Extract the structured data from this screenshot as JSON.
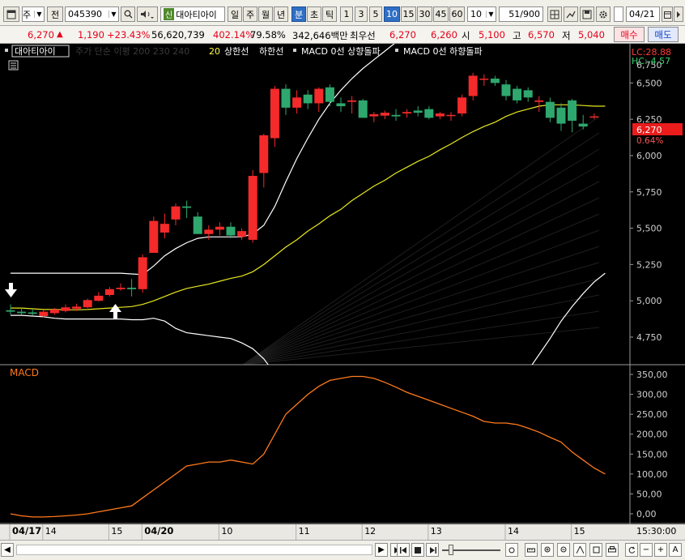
{
  "toolbar": {
    "market": "주",
    "view": "전",
    "code": "045390",
    "stock_name": "대아티아이",
    "badge": "신",
    "periods": [
      "일",
      "주",
      "월",
      "년",
      "분",
      "초",
      "틱"
    ],
    "active_period": "분",
    "intervals": [
      "1",
      "3",
      "5",
      "10",
      "15",
      "30",
      "45",
      "60"
    ],
    "active_interval": "10",
    "interval_value": "10",
    "count": "51",
    "count_total": "/900",
    "date_value": "04/21"
  },
  "quote": {
    "price": "6,270",
    "change_arrow": "▲",
    "change": "1,190",
    "change_pct": "+23.43%",
    "volume": "56,620,739",
    "volume_ratio": "402.14%",
    "turnover": "79.58%",
    "amount": "342,646백만",
    "best_bid_label": "최우선",
    "best_ask": "6,270",
    "best_bid": "6,260",
    "open_label": "시",
    "open": "5,100",
    "high_label": "고",
    "high": "6,570",
    "low_label": "저",
    "low": "5,040",
    "buy_label": "매수",
    "sell_label": "매도"
  },
  "legend": {
    "stock": "대아티아이",
    "ma_label": "주가 단순 이평 200 230 240",
    "envelope_period": "20",
    "envelope_upper": "상한선",
    "envelope_lower": "하한선",
    "macd_up": "MACD 0선 상향돌파",
    "macd_down": "MACD 0선 하향돌파",
    "lc": "LC:28.88",
    "hc": "HC:-4.57"
  },
  "price_axis": {
    "ticks": [
      "6,500",
      "6,250",
      "6,000",
      "5,750",
      "5,500",
      "5,250",
      "5,000",
      "4,750"
    ],
    "top_partial": "6,750",
    "current_price": "6,270",
    "current_pct": "0.64%"
  },
  "macd_panel": {
    "label": "MACD",
    "ticks": [
      "350,00",
      "300,00",
      "250,00",
      "200,00",
      "150,00",
      "100,00",
      "50,00",
      "0,00"
    ]
  },
  "time_axis": {
    "labels": [
      "04/17",
      "14",
      "15",
      "04/20",
      "10",
      "11",
      "12",
      "13",
      "14",
      "15"
    ],
    "clock": "15:30:00"
  },
  "chart_data": [
    {
      "type": "candlestick",
      "title": "",
      "ylim": [
        4560,
        6770
      ],
      "y_ticks": [
        4750,
        5000,
        5250,
        5500,
        5750,
        6000,
        6250,
        6500
      ],
      "grid": false,
      "legend_position": "top-left",
      "colors": {
        "up": "#f52a2a",
        "down": "#2ea86e",
        "ma": "#e8e81f",
        "envelope": "#ffffff",
        "background": "#000000"
      },
      "candles": [
        {
          "o": 4935,
          "h": 4975,
          "l": 4905,
          "c": 4925
        },
        {
          "o": 4925,
          "h": 4950,
          "l": 4905,
          "c": 4915
        },
        {
          "o": 4920,
          "h": 4945,
          "l": 4900,
          "c": 4910
        },
        {
          "o": 4895,
          "h": 4935,
          "l": 4885,
          "c": 4925
        },
        {
          "o": 4915,
          "h": 4950,
          "l": 4905,
          "c": 4940
        },
        {
          "o": 4930,
          "h": 4975,
          "l": 4920,
          "c": 4955
        },
        {
          "o": 4945,
          "h": 4980,
          "l": 4930,
          "c": 4960
        },
        {
          "o": 4955,
          "h": 5015,
          "l": 4950,
          "c": 5005
        },
        {
          "o": 5000,
          "h": 5060,
          "l": 4995,
          "c": 5035
        },
        {
          "o": 5040,
          "h": 5095,
          "l": 5030,
          "c": 5080
        },
        {
          "o": 5080,
          "h": 5120,
          "l": 5070,
          "c": 5090
        },
        {
          "o": 5090,
          "h": 5150,
          "l": 5030,
          "c": 5080
        },
        {
          "o": 5080,
          "h": 5320,
          "l": 5055,
          "c": 5300
        },
        {
          "o": 5330,
          "h": 5580,
          "l": 5330,
          "c": 5550
        },
        {
          "o": 5470,
          "h": 5600,
          "l": 5430,
          "c": 5530
        },
        {
          "o": 5560,
          "h": 5670,
          "l": 5520,
          "c": 5650
        },
        {
          "o": 5650,
          "h": 5690,
          "l": 5570,
          "c": 5640
        },
        {
          "o": 5580,
          "h": 5610,
          "l": 5460,
          "c": 5460
        },
        {
          "o": 5460,
          "h": 5520,
          "l": 5420,
          "c": 5490
        },
        {
          "o": 5490,
          "h": 5540,
          "l": 5450,
          "c": 5510
        },
        {
          "o": 5510,
          "h": 5540,
          "l": 5430,
          "c": 5450
        },
        {
          "o": 5440,
          "h": 5500,
          "l": 5420,
          "c": 5480
        },
        {
          "o": 5420,
          "h": 5900,
          "l": 5400,
          "c": 5860
        },
        {
          "o": 5880,
          "h": 6150,
          "l": 5780,
          "c": 6140
        },
        {
          "o": 6120,
          "h": 6480,
          "l": 6060,
          "c": 6460
        },
        {
          "o": 6460,
          "h": 6490,
          "l": 6280,
          "c": 6330
        },
        {
          "o": 6330,
          "h": 6450,
          "l": 6290,
          "c": 6400
        },
        {
          "o": 6420,
          "h": 6450,
          "l": 6320,
          "c": 6360
        },
        {
          "o": 6360,
          "h": 6470,
          "l": 6300,
          "c": 6460
        },
        {
          "o": 6470,
          "h": 6490,
          "l": 6340,
          "c": 6370
        },
        {
          "o": 6360,
          "h": 6400,
          "l": 6300,
          "c": 6340
        },
        {
          "o": 6370,
          "h": 6410,
          "l": 6290,
          "c": 6380
        },
        {
          "o": 6380,
          "h": 6390,
          "l": 6260,
          "c": 6260
        },
        {
          "o": 6270,
          "h": 6300,
          "l": 6230,
          "c": 6285
        },
        {
          "o": 6275,
          "h": 6310,
          "l": 6250,
          "c": 6295
        },
        {
          "o": 6280,
          "h": 6320,
          "l": 6240,
          "c": 6270
        },
        {
          "o": 6290,
          "h": 6320,
          "l": 6260,
          "c": 6300
        },
        {
          "o": 6310,
          "h": 6340,
          "l": 6270,
          "c": 6295
        },
        {
          "o": 6320,
          "h": 6340,
          "l": 6250,
          "c": 6260
        },
        {
          "o": 6270,
          "h": 6300,
          "l": 6250,
          "c": 6290
        },
        {
          "o": 6280,
          "h": 6300,
          "l": 6240,
          "c": 6280
        },
        {
          "o": 6290,
          "h": 6420,
          "l": 6270,
          "c": 6400
        },
        {
          "o": 6410,
          "h": 6570,
          "l": 6380,
          "c": 6550
        },
        {
          "o": 6530,
          "h": 6560,
          "l": 6480,
          "c": 6530
        },
        {
          "o": 6530,
          "h": 6550,
          "l": 6480,
          "c": 6500
        },
        {
          "o": 6490,
          "h": 6520,
          "l": 6380,
          "c": 6410
        },
        {
          "o": 6460,
          "h": 6480,
          "l": 6360,
          "c": 6380
        },
        {
          "o": 6450,
          "h": 6470,
          "l": 6370,
          "c": 6400
        },
        {
          "o": 6370,
          "h": 6410,
          "l": 6300,
          "c": 6380
        },
        {
          "o": 6370,
          "h": 6400,
          "l": 6230,
          "c": 6260
        },
        {
          "o": 6330,
          "h": 6360,
          "l": 6170,
          "c": 6220
        },
        {
          "o": 6380,
          "h": 6390,
          "l": 6160,
          "c": 6240
        },
        {
          "o": 6220,
          "h": 6280,
          "l": 6180,
          "c": 6200
        },
        {
          "o": 6270,
          "h": 6290,
          "l": 6250,
          "c": 6270
        }
      ],
      "ma20": [
        4950,
        4950,
        4945,
        4940,
        4940,
        4938,
        4938,
        4940,
        4945,
        4950,
        4955,
        4960,
        4975,
        5000,
        5030,
        5060,
        5085,
        5100,
        5115,
        5135,
        5155,
        5170,
        5200,
        5250,
        5310,
        5370,
        5420,
        5480,
        5530,
        5585,
        5630,
        5690,
        5740,
        5790,
        5830,
        5880,
        5920,
        5960,
        5995,
        6040,
        6080,
        6125,
        6165,
        6200,
        6230,
        6270,
        6300,
        6320,
        6340,
        6350,
        6350,
        6350,
        6345,
        6340,
        6340
      ],
      "envelope_upper": [
        5190,
        5190,
        5190,
        5190,
        5190,
        5190,
        5190,
        5190,
        5190,
        5190,
        5190,
        5185,
        5180,
        5240,
        5310,
        5360,
        5400,
        5430,
        5440,
        5440,
        5440,
        5440,
        5460,
        5520,
        5650,
        5820,
        5980,
        6120,
        6250,
        6360,
        6450,
        6530,
        6600,
        6660,
        6720,
        6780,
        6830,
        6870,
        6910,
        6950,
        6990,
        7030,
        7060,
        7090,
        7120,
        7150,
        7170,
        7190,
        7210,
        7230,
        7250,
        7270,
        7290,
        7300,
        7310
      ],
      "envelope_lower": [
        4900,
        4900,
        4895,
        4890,
        4880,
        4875,
        4875,
        4875,
        4875,
        4875,
        4875,
        4870,
        4870,
        4880,
        4860,
        4810,
        4780,
        4770,
        4760,
        4750,
        4740,
        4710,
        4670,
        4600,
        4500,
        4400,
        4310,
        4230,
        4150,
        4080,
        4020,
        3960,
        3920,
        3890,
        3870,
        3860,
        3860,
        3870,
        3880,
        3910,
        3950,
        4000,
        4070,
        4150,
        4230,
        4320,
        4420,
        4520,
        4630,
        4740,
        4860,
        4960,
        5050,
        5130,
        5190
      ]
    },
    {
      "type": "line",
      "title": "",
      "ylabel": "MACD",
      "ylim": [
        -10,
        360
      ],
      "y_ticks": [
        0,
        50,
        100,
        150,
        200,
        250,
        300,
        350
      ],
      "series": [
        {
          "name": "MACD",
          "color": "#ff7a1a",
          "values": [
            0,
            -5,
            -8,
            -8,
            -7,
            -5,
            -3,
            0,
            5,
            10,
            15,
            20,
            40,
            60,
            80,
            100,
            120,
            125,
            130,
            130,
            135,
            130,
            125,
            150,
            200,
            250,
            275,
            300,
            320,
            335,
            340,
            345,
            345,
            340,
            330,
            318,
            305,
            295,
            285,
            275,
            265,
            255,
            245,
            232,
            228,
            228,
            224,
            215,
            205,
            192,
            180,
            155,
            135,
            115,
            100
          ]
        }
      ]
    }
  ]
}
